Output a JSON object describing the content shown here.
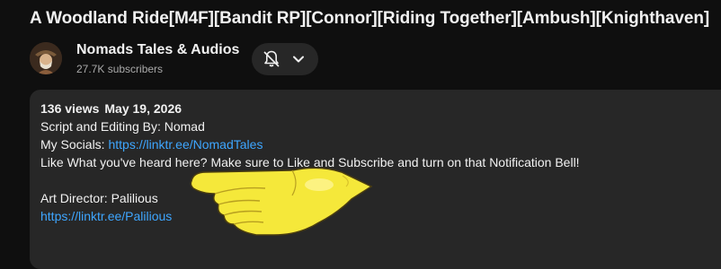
{
  "video": {
    "title": "A Woodland Ride[M4F][Bandit RP][Connor][Riding Together][Ambush][Knighthaven]"
  },
  "channel": {
    "name": "Nomads Tales & Audios",
    "subscribers": "27.7K subscribers",
    "avatar_icon": "channel-avatar-icon"
  },
  "subscribe_button": {
    "bell_icon": "bell-off-icon",
    "dropdown_icon": "chevron-down-icon"
  },
  "description": {
    "views": "136 views",
    "date": "May 19, 2026",
    "line1": "Script and Editing By: Nomad",
    "socials_label": "My Socials: ",
    "socials_link": "https://linktr.ee/NomadTales",
    "line3": "Like What you've heard here? Make sure to Like and Subscribe and turn on that Notification Bell!",
    "art_director": "Art Director: Palilious",
    "art_link": "https://linktr.ee/Palilious"
  },
  "colors": {
    "background": "#0f0f0f",
    "panel": "#272727",
    "link": "#3ea6ff",
    "secondary_text": "#aaaaaa",
    "pointer_hand": "#f5e83a"
  }
}
